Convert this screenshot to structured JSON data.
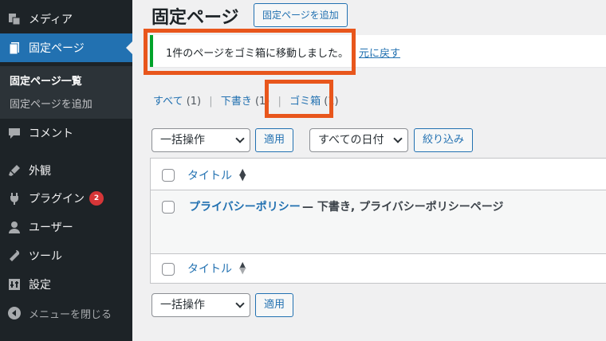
{
  "sidebar": {
    "items": [
      {
        "label": "メディア",
        "icon": "media-icon"
      },
      {
        "label": "固定ページ",
        "icon": "page-icon",
        "active": true
      },
      {
        "label": "コメント",
        "icon": "comment-icon"
      },
      {
        "label": "外観",
        "icon": "paintbrush-icon"
      },
      {
        "label": "プラグイン",
        "icon": "plugin-icon",
        "badge": "2"
      },
      {
        "label": "ユーザー",
        "icon": "user-icon"
      },
      {
        "label": "ツール",
        "icon": "wrench-icon"
      },
      {
        "label": "設定",
        "icon": "settings-icon"
      },
      {
        "label": "メニューを閉じる",
        "icon": "collapse-icon"
      }
    ],
    "submenu": [
      {
        "label": "固定ページ一覧",
        "current": true
      },
      {
        "label": "固定ページを追加"
      }
    ]
  },
  "header": {
    "title": "固定ページ",
    "add_button": "固定ページを追加"
  },
  "notice": {
    "message": "1件のページをゴミ箱に移動しました。",
    "undo": "元に戻す"
  },
  "views": {
    "all_label": "すべて",
    "all_count": "(1)",
    "draft_label": "下書き",
    "draft_count": "(1)",
    "trash_label": "ゴミ箱",
    "trash_count": "(1)"
  },
  "filters": {
    "bulk_action": "一括操作",
    "apply": "適用",
    "date": "すべての日付",
    "filter": "絞り込み"
  },
  "table": {
    "column_title": "タイトル",
    "rows": [
      {
        "title": "プライバシーポリシー",
        "state": "— 下書き, プライバシーポリシーページ"
      }
    ]
  },
  "colors": {
    "sidebar_bg": "#1d2327",
    "accent": "#2271b1",
    "highlight_outline": "#e8561c",
    "notice_border": "#00a32a"
  }
}
